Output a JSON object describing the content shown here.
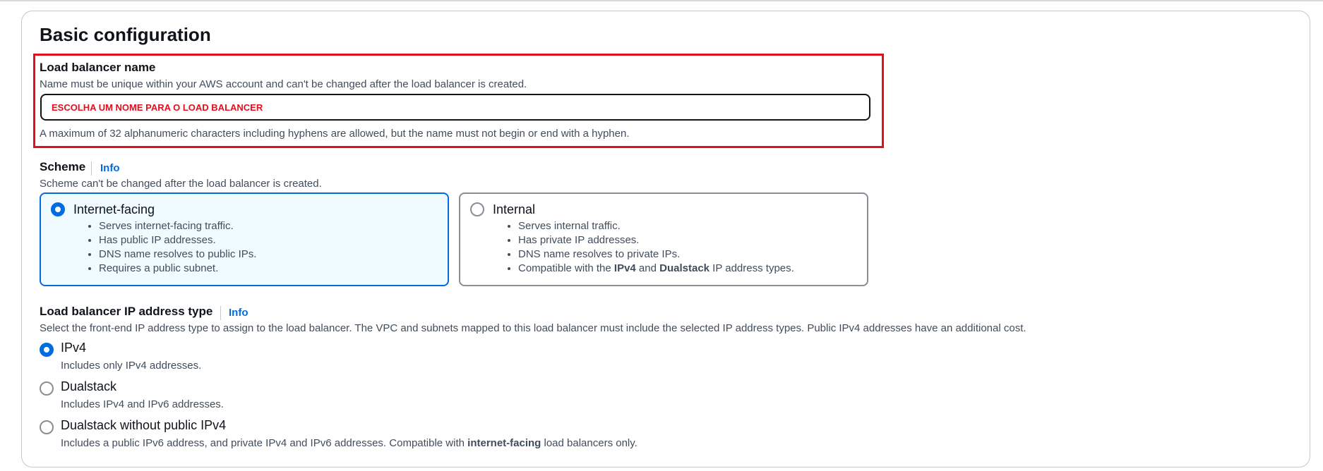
{
  "section": {
    "title": "Basic configuration"
  },
  "lb_name": {
    "label": "Load balancer name",
    "description": "Name must be unique within your AWS account and can't be changed after the load balancer is created.",
    "placeholder": "ESCOLHA UM NOME PARA O LOAD BALANCER",
    "constraint": "A maximum of 32 alphanumeric characters including hyphens are allowed, but the name must not begin or end with a hyphen."
  },
  "scheme": {
    "label": "Scheme",
    "info": "Info",
    "description": "Scheme can't be changed after the load balancer is created.",
    "options": [
      {
        "label": "Internet-facing",
        "selected": true,
        "bullets": [
          "Serves internet-facing traffic.",
          "Has public IP addresses.",
          "DNS name resolves to public IPs.",
          "Requires a public subnet."
        ]
      },
      {
        "label": "Internal",
        "selected": false,
        "bullets": [
          "Serves internal traffic.",
          "Has private IP addresses.",
          "DNS name resolves to private IPs."
        ],
        "bullet4": {
          "pre": "Compatible with the ",
          "b1": "IPv4",
          "mid": " and ",
          "b2": "Dualstack",
          "post": " IP address types."
        }
      }
    ]
  },
  "ip_type": {
    "label": "Load balancer IP address type",
    "info": "Info",
    "description": "Select the front-end IP address type to assign to the load balancer. The VPC and subnets mapped to this load balancer must include the selected IP address types. Public IPv4 addresses have an additional cost.",
    "options": [
      {
        "label": "IPv4",
        "desc": "Includes only IPv4 addresses.",
        "selected": true
      },
      {
        "label": "Dualstack",
        "desc": "Includes IPv4 and IPv6 addresses.",
        "selected": false
      },
      {
        "label": "Dualstack without public IPv4",
        "desc_pre": "Includes a public IPv6 address, and private IPv4 and IPv6 addresses. Compatible with ",
        "desc_bold": "internet-facing",
        "desc_post": " load balancers only.",
        "selected": false
      }
    ]
  },
  "colors": {
    "accent": "#006ce0",
    "highlight": "#e0101e",
    "selected_bg": "#f0fbff"
  }
}
